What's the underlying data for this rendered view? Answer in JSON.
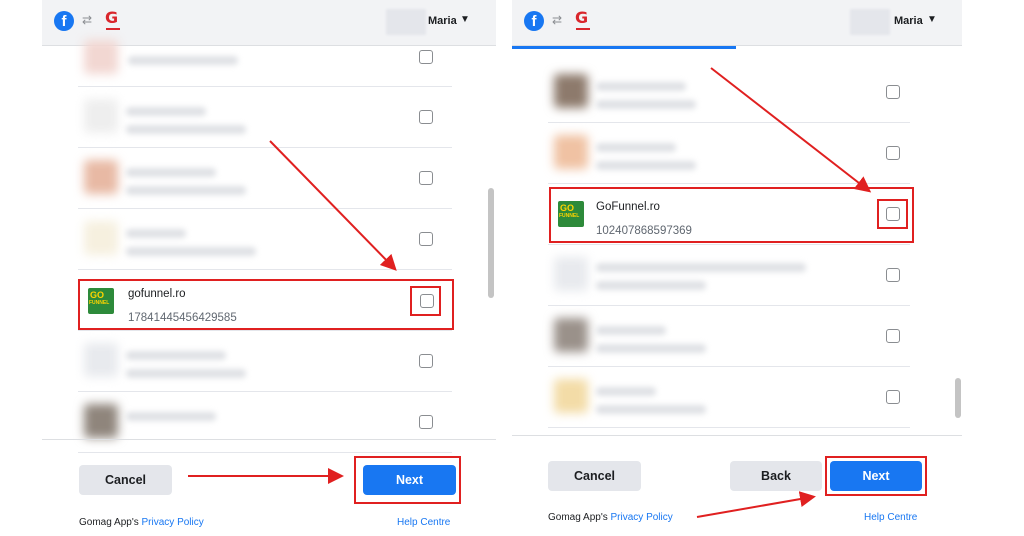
{
  "header": {
    "user_name": "Maria",
    "caret": "▼",
    "fb_letter": "f",
    "brand_letter": "G",
    "swap_glyph": "⇄"
  },
  "icons": [
    "facebook-logo-icon",
    "swap-icon",
    "gomag-logo-icon",
    "caret-down-icon",
    "checkbox-icon",
    "red-arrow-annotation"
  ],
  "colors": {
    "accent": "#1877f2",
    "annotation": "#e02020",
    "page_thumb": "#2d8a3a"
  },
  "left": {
    "page_name": "gofunnel.ro",
    "page_id": "17841445456429585",
    "thumb_text": {
      "line1": "GO",
      "line2": "FUNNEL"
    },
    "buttons": {
      "cancel": "Cancel",
      "next": "Next"
    },
    "footer": {
      "policy_prefix": "Gomag App's",
      "policy_link": "Privacy Policy",
      "help": "Help Centre"
    }
  },
  "right": {
    "page_name": "GoFunnel.ro",
    "page_id": "102407868597369",
    "thumb_text": {
      "line1": "GO",
      "line2": "FUNNEL"
    },
    "buttons": {
      "cancel": "Cancel",
      "back": "Back",
      "next": "Next"
    },
    "footer": {
      "policy_prefix": "Gomag App's",
      "policy_link": "Privacy Policy",
      "help": "Help Centre"
    }
  }
}
